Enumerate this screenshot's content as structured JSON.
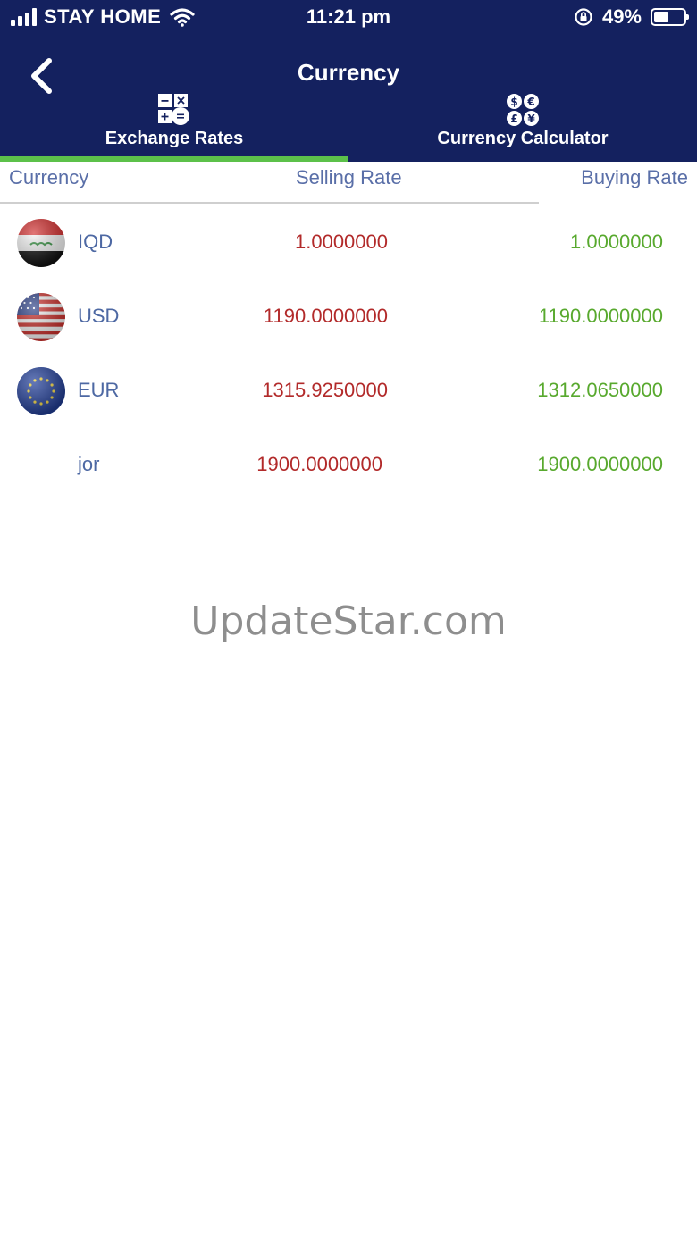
{
  "status_bar": {
    "carrier": "STAY HOME",
    "time": "11:21 pm",
    "battery_percent": "49%",
    "battery_level": 0.49
  },
  "nav": {
    "title": "Currency",
    "back_icon": "chevron-left-icon"
  },
  "tabs": [
    {
      "label": "Exchange Rates",
      "icon": "calculator-icon",
      "active": true
    },
    {
      "label": "Currency Calculator",
      "icon": "currency-symbols-icon",
      "active": false
    }
  ],
  "table": {
    "headers": [
      "Currency",
      "Selling Rate",
      "Buying Rate"
    ],
    "rows": [
      {
        "code": "IQD",
        "selling": "1.0000000",
        "buying": "1.0000000",
        "flag": "iraq-flag-icon"
      },
      {
        "code": "USD",
        "selling": "1190.0000000",
        "buying": "1190.0000000",
        "flag": "usa-flag-icon"
      },
      {
        "code": "EUR",
        "selling": "1315.9250000",
        "buying": "1312.0650000",
        "flag": "eu-flag-icon"
      },
      {
        "code": "jor",
        "selling": "1900.0000000",
        "buying": "1900.0000000",
        "flag": ""
      }
    ]
  },
  "watermark": "UpdateStar.com",
  "colors": {
    "header_bg": "#14215f",
    "tab_indicator": "#5cc14a",
    "selling": "#b22a2a",
    "buying": "#58a92e",
    "label": "#5a6fa8"
  }
}
